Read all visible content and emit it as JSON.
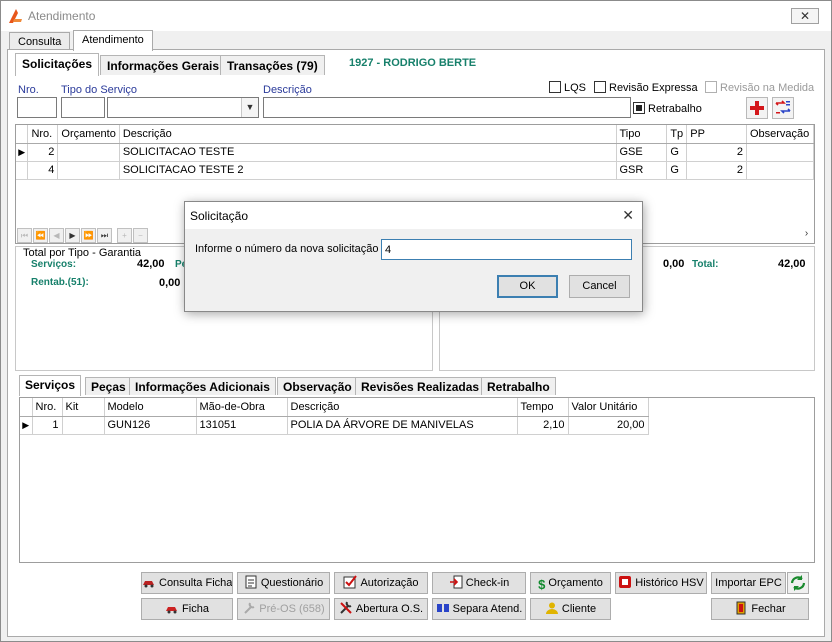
{
  "window": {
    "title": "Atendimento",
    "close_glyph": "✕"
  },
  "top_tabs": [
    "Consulta",
    "Atendimento"
  ],
  "sub_tabs": [
    "Solicitações",
    "Informações Gerais",
    "Transações (79)"
  ],
  "client_name": "1927 - RODRIGO BERTE",
  "form": {
    "nro_label": "Nro.",
    "tipo_label": "Tipo do Serviço",
    "descricao_label": "Descrição",
    "checkboxes": {
      "lqs": "LQS",
      "revisao_expressa": "Revisão Expressa",
      "revisao_medida": "Revisão na Medida",
      "retrabalho": "Retrabalho"
    }
  },
  "solicitacoes": {
    "columns": [
      "Nro.",
      "Orçamento",
      "Descrição",
      "Tipo",
      "Tp",
      "PP",
      "Observação"
    ],
    "rows": [
      {
        "nro": "2",
        "orcamento": "",
        "descricao": "SOLICITACAO TESTE",
        "tipo": "GSE",
        "tp": "G",
        "pp": "2",
        "obs": ""
      },
      {
        "nro": "4",
        "orcamento": "",
        "descricao": "SOLICITACAO TESTE 2",
        "tipo": "GSR",
        "tp": "G",
        "pp": "2",
        "obs": ""
      }
    ]
  },
  "summary": {
    "title": "Total por Tipo - Garantia",
    "servicos_label": "Serviços:",
    "servicos_value": "42,00",
    "pe_label": "Pe",
    "rentab_label": "Rentab.(51):",
    "rentab_value": "0,00",
    "right_value1": "0,00",
    "total_label": "Total:",
    "total_value": "42,00"
  },
  "bottom_tabs": [
    "Serviços",
    "Peças",
    "Informações Adicionais",
    "Observação",
    "Revisões Realizadas",
    "Retrabalho"
  ],
  "servicos_grid": {
    "columns": [
      "Nro.",
      "Kit",
      "Modelo",
      "Mão-de-Obra",
      "Descrição",
      "Tempo",
      "Valor Unitário"
    ],
    "rows": [
      {
        "nro": "1",
        "kit": "",
        "modelo": "GUN126",
        "mao": "131051",
        "descricao": "POLIA DA ÁRVORE DE MANIVELAS",
        "tempo": "2,10",
        "valor": "20,00"
      }
    ]
  },
  "buttons": {
    "consulta_ficha": "Consulta Ficha",
    "questionario": "Questionário",
    "autorizacao": "Autorização",
    "check_in": "Check-in",
    "orcamento": "Orçamento",
    "historico_hsv": "Histórico HSV",
    "importar_epc": "Importar EPC",
    "ficha": "Ficha",
    "pre_os": "Pré-OS (658)",
    "abertura_os": "Abertura O.S.",
    "separa_atend": "Separa Atend.",
    "cliente": "Cliente",
    "fechar": "Fechar"
  },
  "dialog": {
    "title": "Solicitação",
    "close_glyph": "✕",
    "label": "Informe o número da nova solicitação",
    "value": "4",
    "ok": "OK",
    "cancel": "Cancel"
  },
  "colors": {
    "teal": "#17806b",
    "label_blue": "#2a3a9a",
    "focus_blue": "#3c7fb1"
  }
}
